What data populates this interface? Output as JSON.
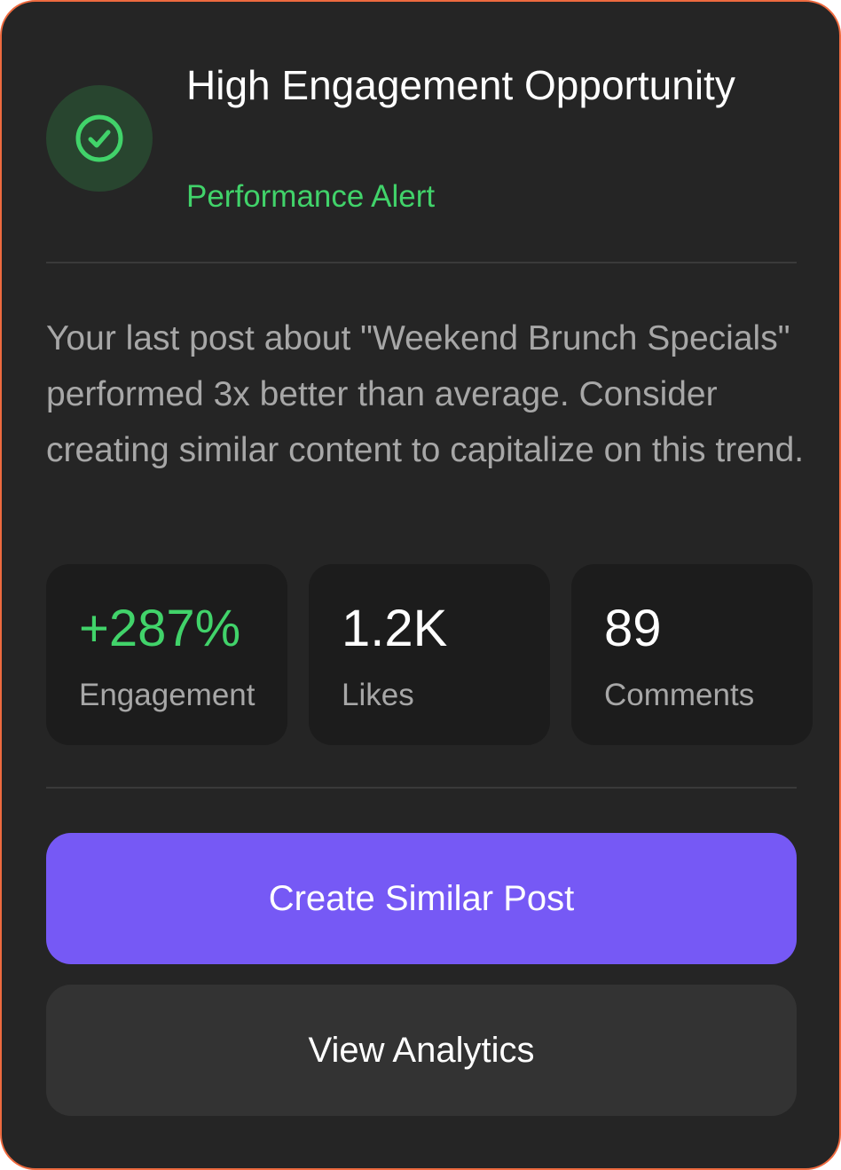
{
  "alert": {
    "icon": "check-circle-icon",
    "title": "High Engagement Opportunity",
    "category": "Performance Alert",
    "description": "Your last post about \"Weekend Brunch Specials\" performed 3x better than average. Consider creating similar content to capitalize on this trend."
  },
  "stats": [
    {
      "value": "+287%",
      "label": "Engagement"
    },
    {
      "value": "1.2K",
      "label": "Likes"
    },
    {
      "value": "89",
      "label": "Comments"
    }
  ],
  "actions": {
    "primary_label": "Create Similar Post",
    "secondary_label": "View Analytics"
  },
  "colors": {
    "accent_green": "#41d36a",
    "primary_button": "#7659f5",
    "card_border": "#ee6a3f",
    "card_background": "#252525"
  }
}
